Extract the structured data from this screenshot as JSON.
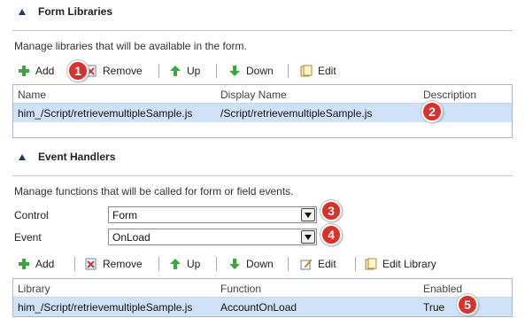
{
  "form_libraries": {
    "title": "Form Libraries",
    "description": "Manage libraries that will be available in the form.",
    "toolbar": {
      "add": "Add",
      "remove": "Remove",
      "up": "Up",
      "down": "Down",
      "edit": "Edit"
    },
    "columns": {
      "name": "Name",
      "display_name": "Display Name",
      "description": "Description"
    },
    "rows": [
      {
        "name": "him_/Script/retrievemultipleSample.js",
        "display_name": "/Script/retrievemultipleSample.js",
        "description": ""
      }
    ]
  },
  "event_handlers": {
    "title": "Event Handlers",
    "description": "Manage functions that will be called for form or field events.",
    "control": {
      "label": "Control",
      "value": "Form"
    },
    "event": {
      "label": "Event",
      "value": "OnLoad"
    },
    "toolbar": {
      "add": "Add",
      "remove": "Remove",
      "up": "Up",
      "down": "Down",
      "edit": "Edit",
      "edit_library": "Edit Library"
    },
    "columns": {
      "library": "Library",
      "function": "Function",
      "enabled": "Enabled"
    },
    "rows": [
      {
        "library": "him_/Script/retrievemultipleSample.js",
        "function": "AccountOnLoad",
        "enabled": "True"
      }
    ]
  },
  "badges": [
    "1",
    "2",
    "3",
    "4",
    "5"
  ],
  "colors": {
    "badge": "#d9312b",
    "selected_row": "#cfe2f7",
    "accent": "#1f3a60"
  }
}
